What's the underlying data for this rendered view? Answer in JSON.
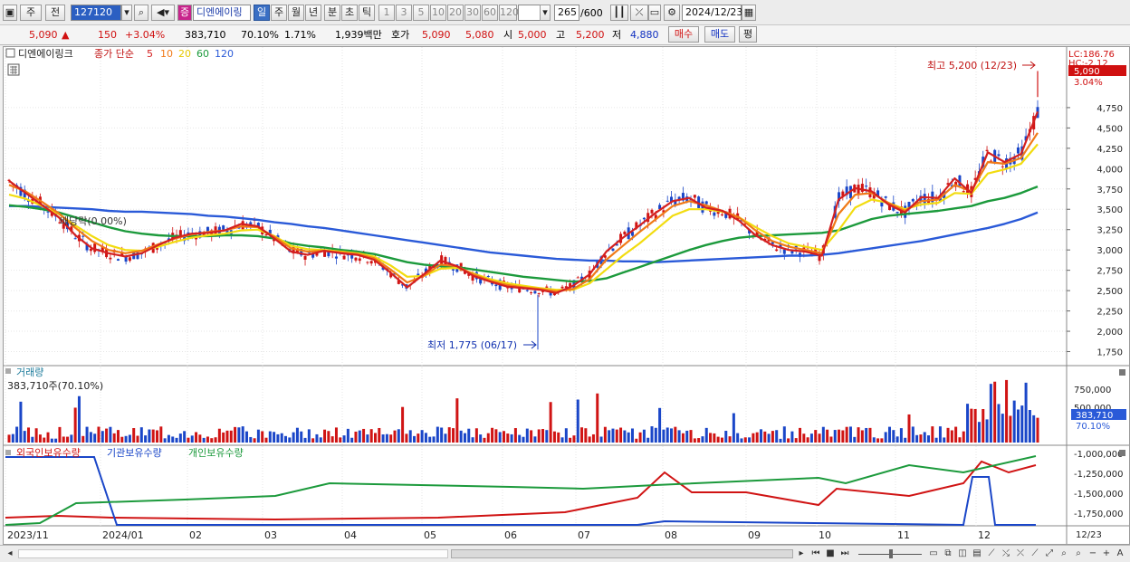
{
  "toolbar": {
    "market": "주",
    "prev": "전",
    "code": "127120",
    "stock_tag": "증",
    "stock_name": "디엔에이링",
    "periods": [
      "일",
      "주",
      "월",
      "년",
      "분",
      "초",
      "틱"
    ],
    "ticks": [
      "1",
      "3",
      "5",
      "10",
      "20",
      "30",
      "60",
      "120"
    ],
    "count": "265",
    "count_max": "/600",
    "date": "2024/12/23"
  },
  "quote": {
    "price": "5,090",
    "change": "150",
    "change_pct": "+3.04%",
    "volume": "383,710",
    "vol_ratio": "70.10%",
    "turnover_pct": "1.71%",
    "amount": "1,939백만",
    "ask_label": "호가",
    "ask": "5,090",
    "bid": "5,080",
    "open_label": "시",
    "open": "5,000",
    "high_label": "고",
    "high": "5,200",
    "low_label": "저",
    "low": "4,880",
    "buy_label": "매수",
    "sell_label": "매도",
    "avg_label": "평"
  },
  "price_panel": {
    "title": "디엔에이링크",
    "ma_label": "종가 단순",
    "ma_periods": [
      "5",
      "10",
      "20",
      "60",
      "120"
    ],
    "lc_label": "LC:186.76",
    "hc_label": "HC:-2.12",
    "current_badge": "5,090",
    "current_pct": "3.04%",
    "high_note": "최고 5,200 (12/23)",
    "low_note": "최저 1,775 (06/17)",
    "event_note": "배당락(0.00%)",
    "colors": {
      "up": "#d01414",
      "down": "#1a46c8",
      "ma5": "#d42020",
      "ma10": "#f07a18",
      "ma20": "#f2dc10",
      "ma60": "#1c9a3c",
      "ma120": "#2a5ad8"
    }
  },
  "volume_panel": {
    "title": "거래량",
    "value": "383,710주(70.10%)",
    "badge": "383,710",
    "badge_pct": "70.10%",
    "ticks": [
      "750,000",
      "500,000"
    ]
  },
  "holdings_panel": {
    "foreign": "외국인보유수량",
    "institution": "기관보유수량",
    "individual": "개인보유수량",
    "ticks": [
      "-1,000,000",
      "-1,250,000",
      "-1,500,000",
      "-1,750,000"
    ]
  },
  "x_axis": {
    "labels": [
      "2023/11",
      "2024/01",
      "02",
      "03",
      "04",
      "05",
      "06",
      "07",
      "08",
      "09",
      "10",
      "11",
      "12"
    ],
    "right_label": "12/23"
  },
  "chart_data": {
    "type": "line",
    "ylim": [
      1600,
      5450
    ],
    "yticks": [
      4750,
      4500,
      4250,
      4000,
      3750,
      3500,
      3250,
      3000,
      2750,
      2500,
      2250,
      2000,
      1750
    ],
    "high": {
      "value": 5200,
      "date": "12/23"
    },
    "low": {
      "value": 1775,
      "date": "06/17"
    },
    "series": [
      {
        "name": "5",
        "values": [
          3850,
          3700,
          3550,
          3400,
          3180,
          3020,
          2960,
          2920,
          2960,
          3060,
          3150,
          3200,
          3210,
          3240,
          3320,
          3290,
          3140,
          2980,
          2940,
          2990,
          2960,
          2940,
          2880,
          2720,
          2540,
          2700,
          2870,
          2800,
          2680,
          2610,
          2550,
          2530,
          2510,
          2470,
          2560,
          2700,
          2980,
          3150,
          3300,
          3460,
          3600,
          3640,
          3520,
          3480,
          3360,
          3180,
          3060,
          3000,
          2980,
          2930,
          3620,
          3760,
          3720,
          3560,
          3460,
          3650,
          3640,
          3880,
          3700,
          4200,
          4080,
          4180,
          4700
        ]
      },
      {
        "name": "10",
        "values": [
          3800,
          3720,
          3590,
          3450,
          3270,
          3110,
          3000,
          2960,
          2990,
          3070,
          3140,
          3190,
          3220,
          3240,
          3290,
          3280,
          3160,
          3020,
          2980,
          2990,
          2970,
          2950,
          2900,
          2760,
          2600,
          2680,
          2820,
          2800,
          2700,
          2620,
          2570,
          2540,
          2520,
          2490,
          2520,
          2640,
          2880,
          3050,
          3220,
          3380,
          3540,
          3600,
          3550,
          3480,
          3400,
          3240,
          3110,
          3040,
          3000,
          2960,
          3440,
          3680,
          3700,
          3580,
          3480,
          3600,
          3620,
          3800,
          3720,
          4080,
          4060,
          4130,
          4440
        ]
      },
      {
        "name": "20",
        "values": [
          3680,
          3630,
          3540,
          3440,
          3300,
          3170,
          3060,
          3000,
          2990,
          3040,
          3100,
          3150,
          3180,
          3200,
          3240,
          3250,
          3170,
          3050,
          3010,
          3000,
          2980,
          2960,
          2920,
          2810,
          2670,
          2680,
          2770,
          2780,
          2710,
          2640,
          2590,
          2560,
          2530,
          2510,
          2510,
          2590,
          2760,
          2930,
          3080,
          3250,
          3420,
          3500,
          3500,
          3470,
          3400,
          3280,
          3170,
          3080,
          3040,
          3000,
          3240,
          3520,
          3620,
          3580,
          3500,
          3560,
          3580,
          3700,
          3690,
          3940,
          3990,
          4060,
          4300
        ]
      },
      {
        "name": "60",
        "values": [
          3550,
          3530,
          3500,
          3460,
          3400,
          3340,
          3280,
          3230,
          3200,
          3180,
          3170,
          3170,
          3170,
          3180,
          3180,
          3170,
          3140,
          3080,
          3050,
          3030,
          3000,
          2980,
          2950,
          2900,
          2850,
          2820,
          2800,
          2790,
          2760,
          2730,
          2700,
          2670,
          2650,
          2630,
          2610,
          2620,
          2650,
          2720,
          2790,
          2860,
          2930,
          3000,
          3060,
          3110,
          3150,
          3170,
          3180,
          3190,
          3200,
          3210,
          3240,
          3310,
          3380,
          3420,
          3440,
          3460,
          3480,
          3510,
          3540,
          3600,
          3640,
          3700,
          3780
        ]
      },
      {
        "name": "120",
        "values": [
          3540,
          3540,
          3530,
          3520,
          3510,
          3500,
          3480,
          3470,
          3470,
          3460,
          3450,
          3440,
          3420,
          3410,
          3390,
          3370,
          3340,
          3320,
          3290,
          3270,
          3240,
          3210,
          3180,
          3150,
          3120,
          3090,
          3060,
          3030,
          3000,
          2970,
          2950,
          2930,
          2910,
          2890,
          2880,
          2870,
          2870,
          2860,
          2860,
          2850,
          2860,
          2870,
          2880,
          2890,
          2900,
          2910,
          2920,
          2930,
          2930,
          2940,
          2960,
          2990,
          3020,
          3050,
          3080,
          3110,
          3150,
          3190,
          3230,
          3270,
          3320,
          3380,
          3460
        ]
      }
    ]
  }
}
